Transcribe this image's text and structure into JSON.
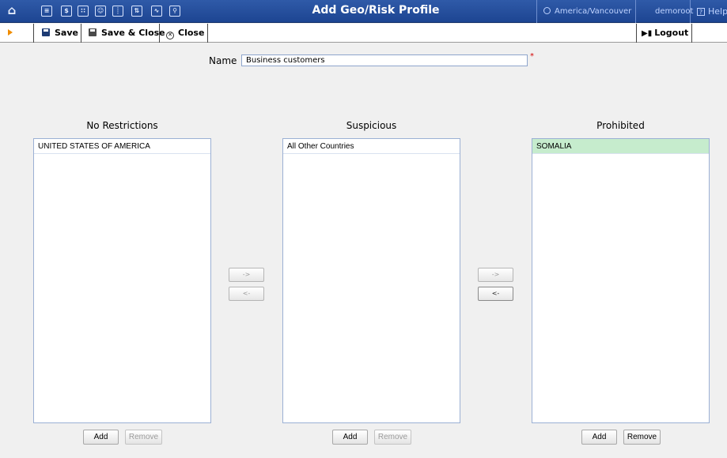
{
  "header": {
    "title": "Add Geo/Risk Profile",
    "timezone": "America/Vancouver",
    "user": "demoroot",
    "help": "Help",
    "nav_icons": [
      "home-icon",
      "list-icon",
      "dollar-icon",
      "grid-icon",
      "person-icon",
      "tree-icon",
      "transfer-icon",
      "chart-icon",
      "search-icon"
    ]
  },
  "toolbar": {
    "save": "Save",
    "save_close": "Save & Close",
    "close": "Close",
    "logout": "Logout"
  },
  "form": {
    "name_label": "Name",
    "name_value": "Business customers",
    "required_mark": "*"
  },
  "columns": [
    {
      "title": "No Restrictions",
      "items": [
        "UNITED STATES OF AMERICA"
      ],
      "add": "Add",
      "remove": "Remove",
      "remove_enabled": false
    },
    {
      "title": "Suspicious",
      "items": [
        "All Other Countries"
      ],
      "add": "Add",
      "remove": "Remove",
      "remove_enabled": false
    },
    {
      "title": "Prohibited",
      "items": [
        "SOMALIA"
      ],
      "selected": 0,
      "add": "Add",
      "remove": "Remove",
      "remove_enabled": true
    }
  ],
  "move_buttons": {
    "right": "->",
    "left": "<-"
  }
}
